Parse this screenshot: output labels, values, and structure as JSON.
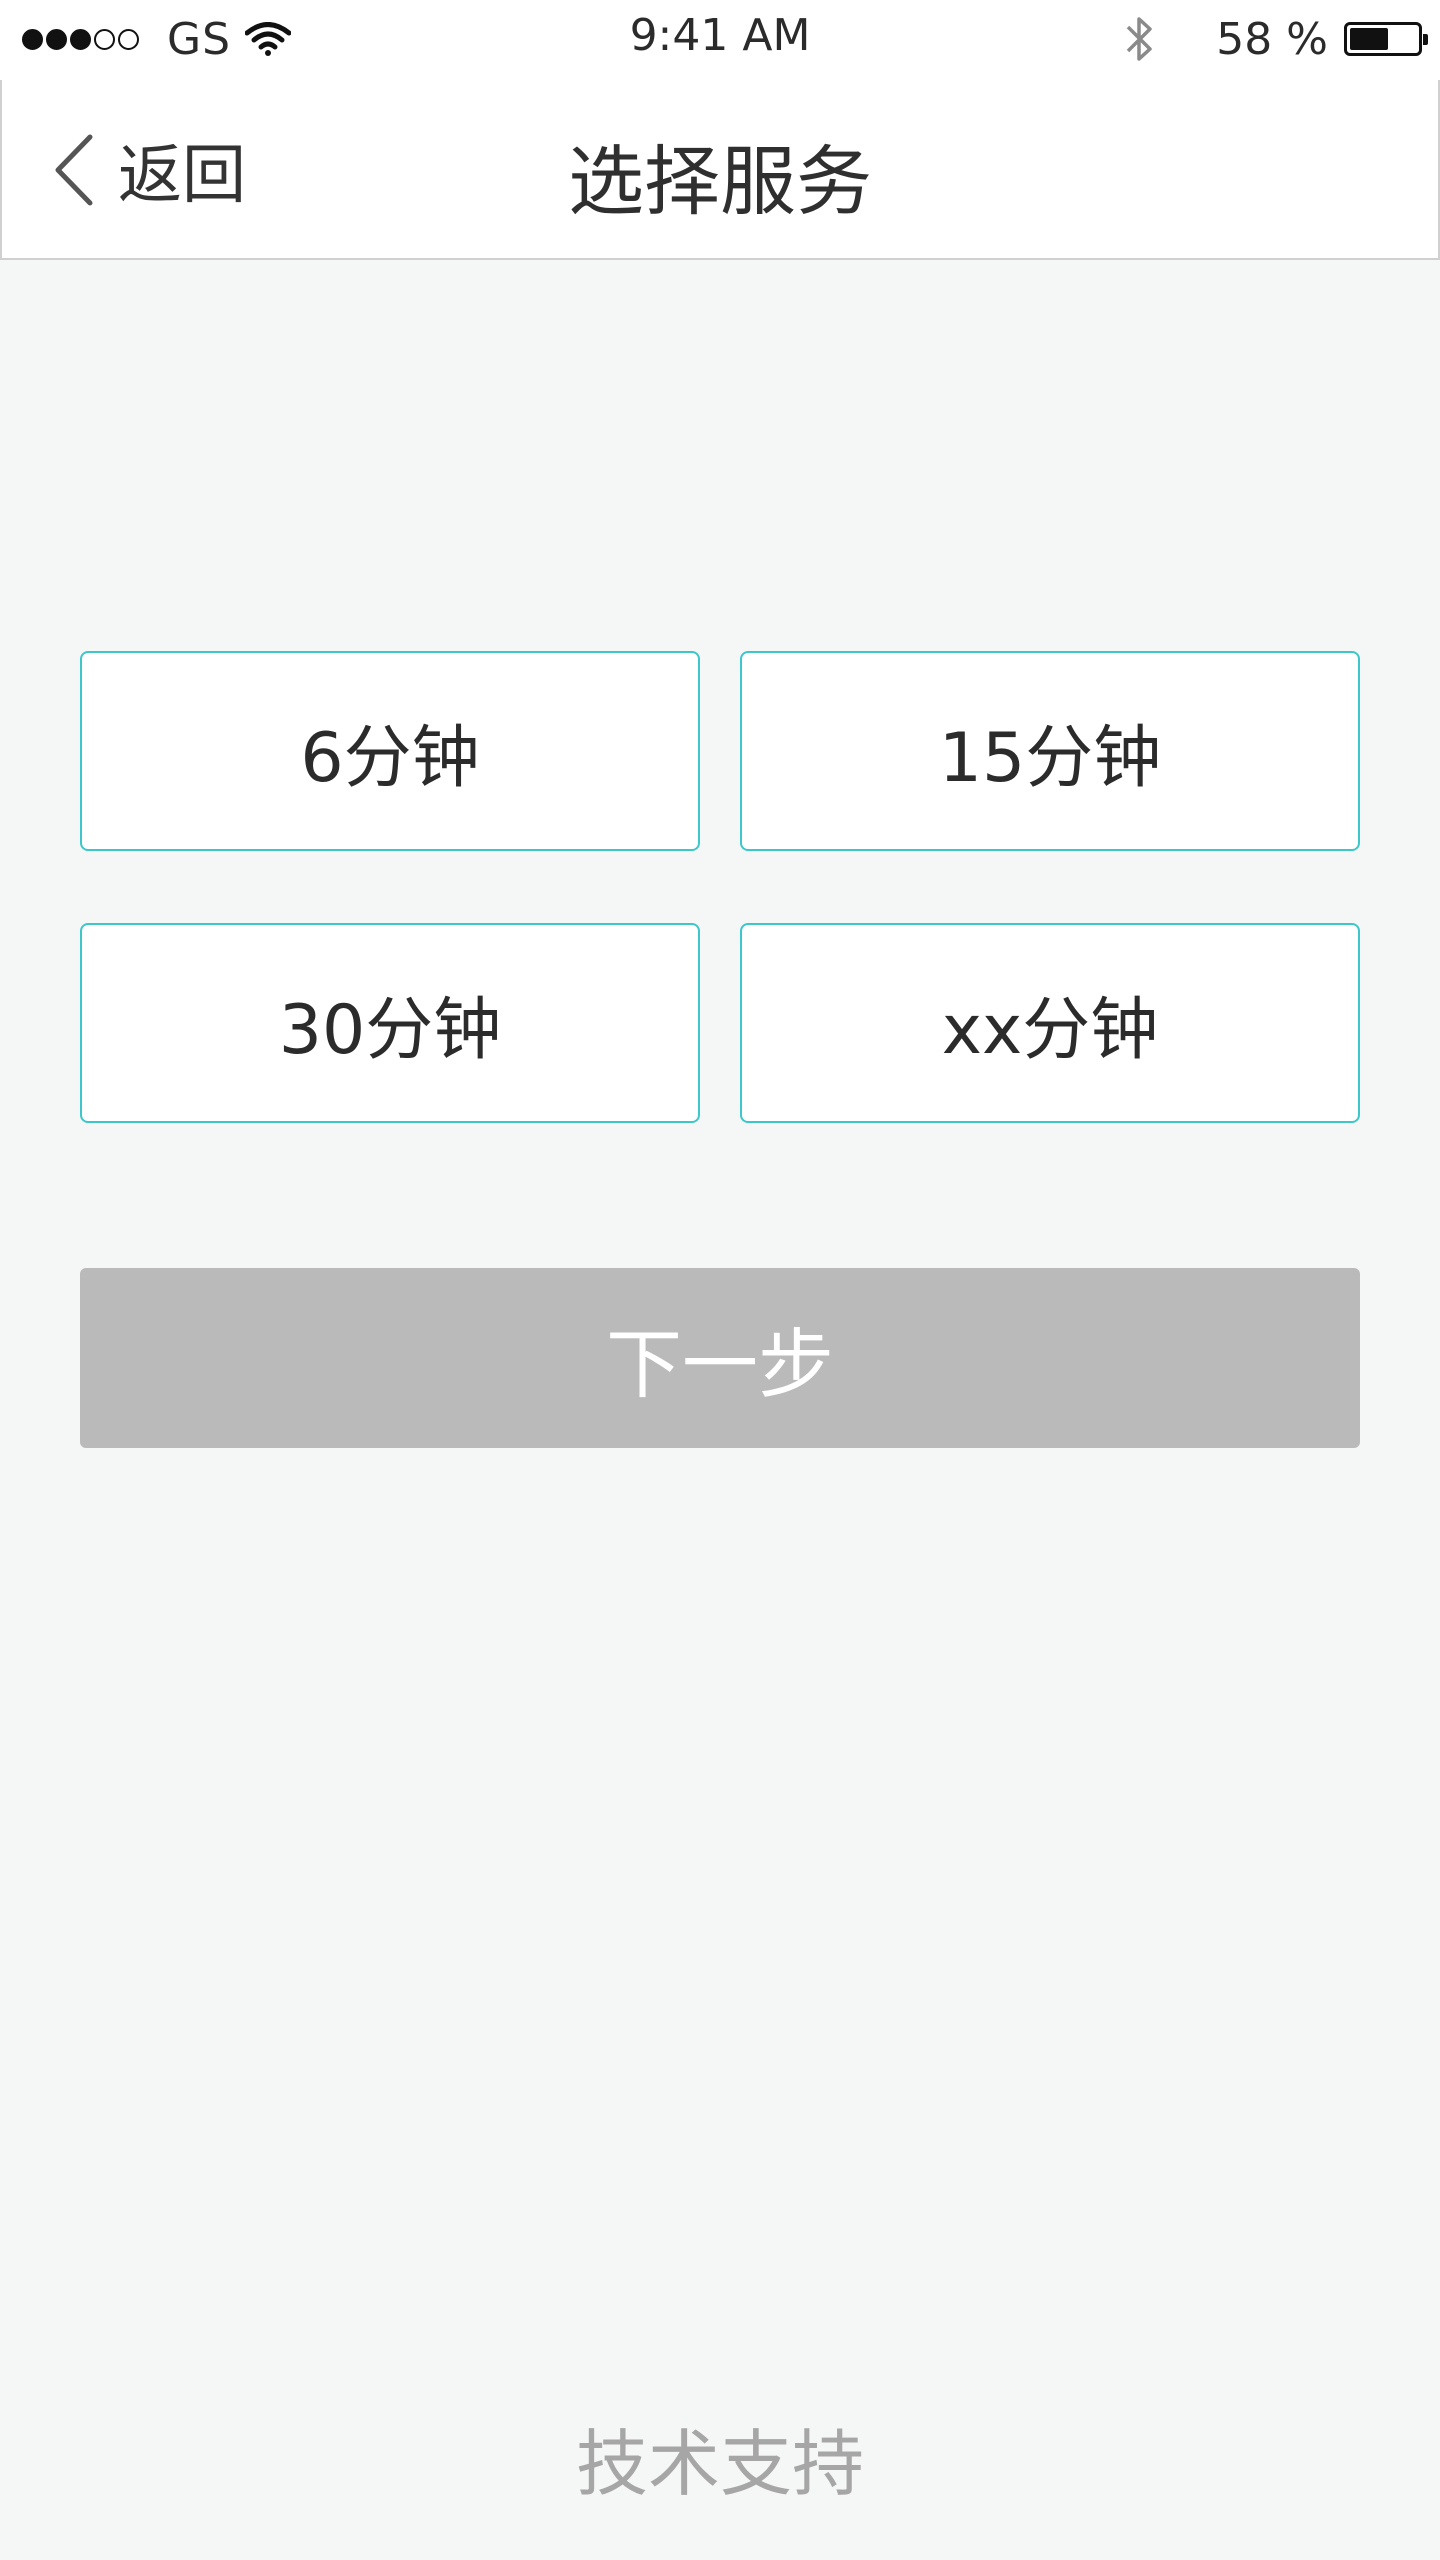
{
  "status_bar": {
    "carrier": "GS",
    "time": "9:41 AM",
    "battery_percent": "58 %",
    "battery_level": 0.58,
    "signal_strength": 3,
    "signal_max": 5,
    "icons": [
      "wifi-icon",
      "bluetooth-icon",
      "battery-icon"
    ]
  },
  "nav": {
    "back_label": "返回",
    "title": "选择服务"
  },
  "options": [
    {
      "label": "6分钟"
    },
    {
      "label": "15分钟"
    },
    {
      "label": "30分钟"
    },
    {
      "label": "xx分钟"
    }
  ],
  "next_button": {
    "label": "下一步"
  },
  "footer": {
    "tech_support": "技术支持"
  },
  "colors": {
    "accent_border": "#3ec7cb",
    "button_disabled": "#bababa",
    "background": "#f5f6f6"
  }
}
